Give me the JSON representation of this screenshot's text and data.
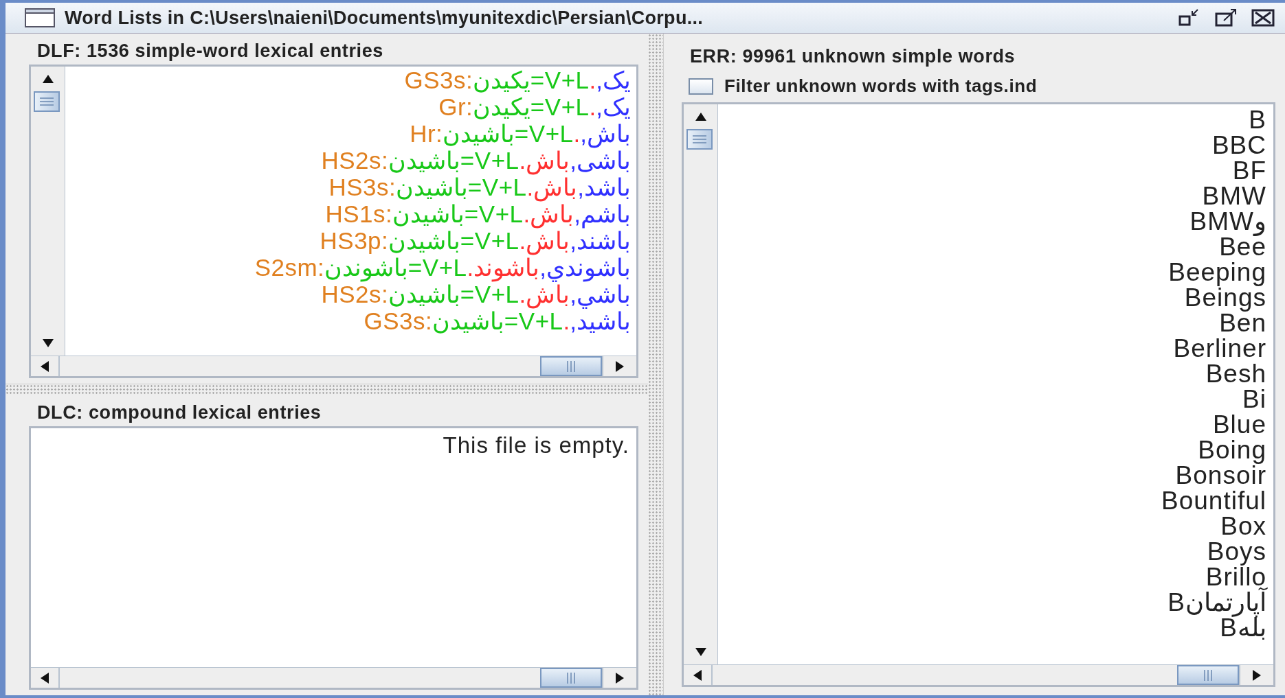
{
  "window": {
    "title": "Word Lists in C:\\Users\\naieni\\Documents\\myunitexdic\\Persian\\Corpu..."
  },
  "dlf": {
    "title": "DLF: 1536 simple-word lexical entries",
    "entries": [
      {
        "parts": [
          {
            "text": "یک,",
            "kind": "form"
          },
          {
            "text": ".",
            "kind": "lemma"
          },
          {
            "text": "V+L=یکیدن",
            "kind": "tag"
          },
          {
            "text": ":GS3s",
            "kind": "code"
          }
        ]
      },
      {
        "parts": [
          {
            "text": "یک,",
            "kind": "form"
          },
          {
            "text": ".",
            "kind": "lemma"
          },
          {
            "text": "V+L=یکیدن",
            "kind": "tag"
          },
          {
            "text": ":Gr",
            "kind": "code"
          }
        ]
      },
      {
        "parts": [
          {
            "text": "باش,",
            "kind": "form"
          },
          {
            "text": ".",
            "kind": "lemma"
          },
          {
            "text": "V+L=باشیدن",
            "kind": "tag"
          },
          {
            "text": ":Hr",
            "kind": "code"
          }
        ]
      },
      {
        "parts": [
          {
            "text": "باشی,",
            "kind": "form"
          },
          {
            "text": "باش.",
            "kind": "lemma"
          },
          {
            "text": "V+L=باشیدن",
            "kind": "tag"
          },
          {
            "text": ":HS2s",
            "kind": "code"
          }
        ]
      },
      {
        "parts": [
          {
            "text": "باشد,",
            "kind": "form"
          },
          {
            "text": "باش.",
            "kind": "lemma"
          },
          {
            "text": "V+L=باشیدن",
            "kind": "tag"
          },
          {
            "text": ":HS3s",
            "kind": "code"
          }
        ]
      },
      {
        "parts": [
          {
            "text": "باشم,",
            "kind": "form"
          },
          {
            "text": "باش.",
            "kind": "lemma"
          },
          {
            "text": "V+L=باشیدن",
            "kind": "tag"
          },
          {
            "text": ":HS1s",
            "kind": "code"
          }
        ]
      },
      {
        "parts": [
          {
            "text": "باشند,",
            "kind": "form"
          },
          {
            "text": "باش.",
            "kind": "lemma"
          },
          {
            "text": "V+L=باشیدن",
            "kind": "tag"
          },
          {
            "text": ":HS3p",
            "kind": "code"
          }
        ]
      },
      {
        "parts": [
          {
            "text": "باشوندي,",
            "kind": "form"
          },
          {
            "text": "باشوند.",
            "kind": "lemma"
          },
          {
            "text": "V+L=باشوندن",
            "kind": "tag"
          },
          {
            "text": ":S2sm",
            "kind": "code"
          }
        ]
      },
      {
        "parts": [
          {
            "text": "باشي,",
            "kind": "form"
          },
          {
            "text": "باش.",
            "kind": "lemma"
          },
          {
            "text": "V+L=باشیدن",
            "kind": "tag"
          },
          {
            "text": ":HS2s",
            "kind": "code"
          }
        ]
      },
      {
        "parts": [
          {
            "text": "باشید,",
            "kind": "form"
          },
          {
            "text": ".",
            "kind": "lemma"
          },
          {
            "text": "V+L=باشیدن",
            "kind": "tag"
          },
          {
            "text": ":GS3s",
            "kind": "code"
          }
        ]
      }
    ]
  },
  "dlc": {
    "title": "DLC: compound lexical entries",
    "message": "This file is empty."
  },
  "err": {
    "title": "ERR: 99961 unknown simple words",
    "filter": {
      "label": "Filter unknown words with tags.ind",
      "checked": false
    },
    "words": [
      "B",
      "BBC",
      "BF",
      "BMW",
      "BMWو",
      "Bee",
      "Beeping",
      "Beings",
      "Ben",
      "Berliner",
      "Besh",
      "Bi",
      "Blue",
      "Boing",
      "Bonsoir",
      "Bountiful",
      "Box",
      "Boys",
      "Brillo",
      "Bآپارتمان",
      "Bبله"
    ]
  }
}
